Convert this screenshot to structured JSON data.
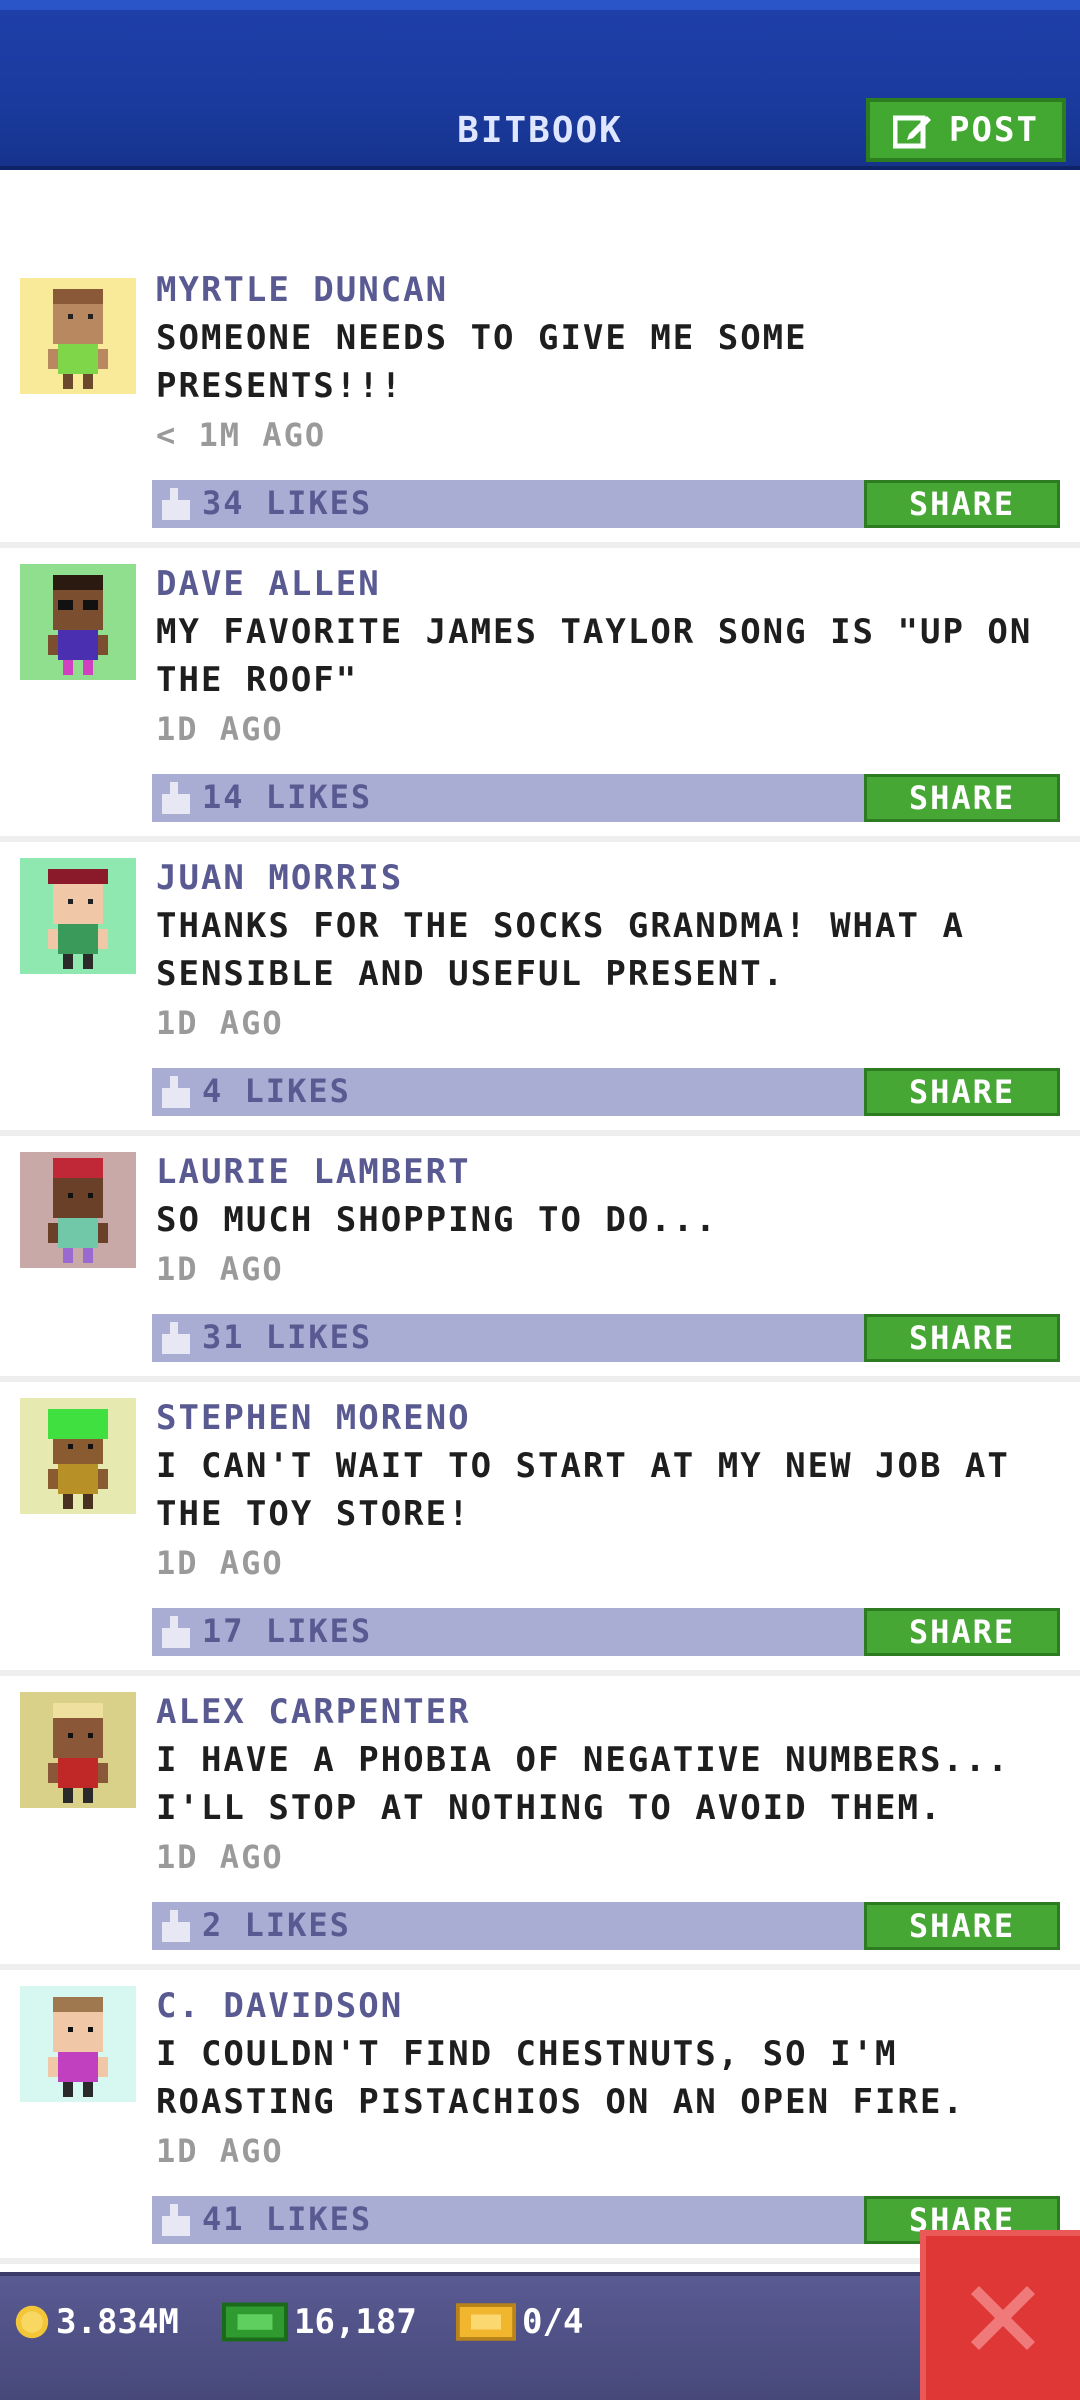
{
  "header": {
    "title": "BITBOOK",
    "post_label": "POST"
  },
  "colors": {
    "header_blue": "#1a3a9e",
    "share_green": "#46a734",
    "likes_bar": "#aaadd3",
    "close_red": "#df3636"
  },
  "posts": [
    {
      "author": "MYRTLE DUNCAN",
      "message": "SOMEONE NEEDS TO GIVE ME SOME PRESENTS!!!",
      "time": "< 1M AGO",
      "likes": "34 LIKES",
      "share": "SHARE",
      "avatar_bg": "#f9ea9a"
    },
    {
      "author": "DAVE ALLEN",
      "message": "MY FAVORITE JAMES TAYLOR SONG IS \"UP ON THE ROOF\"",
      "time": "1D AGO",
      "likes": "14 LIKES",
      "share": "SHARE",
      "avatar_bg": "#8fdf8f"
    },
    {
      "author": "JUAN MORRIS",
      "message": "THANKS FOR THE SOCKS GRANDMA! WHAT A SENSIBLE AND USEFUL PRESENT.",
      "time": "1D AGO",
      "likes": "4 LIKES",
      "share": "SHARE",
      "avatar_bg": "#8fe8b0"
    },
    {
      "author": "LAURIE LAMBERT",
      "message": "SO MUCH SHOPPING TO DO...",
      "time": "1D AGO",
      "likes": "31 LIKES",
      "share": "SHARE",
      "avatar_bg": "#c9a8a8"
    },
    {
      "author": "STEPHEN MORENO",
      "message": "I CAN'T WAIT TO START AT MY NEW JOB AT THE TOY STORE!",
      "time": "1D AGO",
      "likes": "17 LIKES",
      "share": "SHARE",
      "avatar_bg": "#e6eab0"
    },
    {
      "author": "ALEX CARPENTER",
      "message": "I HAVE A PHOBIA OF NEGATIVE NUMBERS... I'LL STOP AT NOTHING TO AVOID THEM.",
      "time": "1D AGO",
      "likes": "2 LIKES",
      "share": "SHARE",
      "avatar_bg": "#d9d08a"
    },
    {
      "author": "C. DAVIDSON",
      "message": "I COULDN'T FIND CHESTNUTS, SO I'M ROASTING PISTACHIOS ON AN OPEN FIRE.",
      "time": "1D AGO",
      "likes": "41 LIKES",
      "share": "SHARE",
      "avatar_bg": "#d6f8f0"
    }
  ],
  "footer": {
    "coins": "3.834M",
    "bux": "16,187",
    "tickets": "0/4"
  }
}
